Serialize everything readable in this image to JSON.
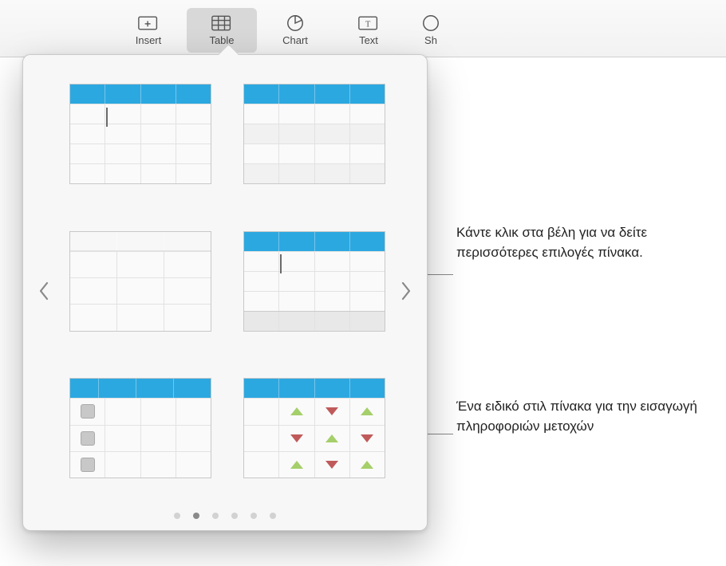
{
  "toolbar": {
    "items": [
      {
        "id": "insert",
        "label": "Insert",
        "active": false
      },
      {
        "id": "table",
        "label": "Table",
        "active": true
      },
      {
        "id": "chart",
        "label": "Chart",
        "active": false
      },
      {
        "id": "text",
        "label": "Text",
        "active": false
      },
      {
        "id": "shape",
        "label": "Shape",
        "active": false
      }
    ]
  },
  "popover": {
    "pages": {
      "total": 6,
      "current": 2
    },
    "styles": [
      {
        "id": "header-simple",
        "header": "blue",
        "rows": 4,
        "cols": 4,
        "cursor": [
          1,
          1
        ]
      },
      {
        "id": "header-banded",
        "header": "blue",
        "rows": 4,
        "cols": 4,
        "banded": true
      },
      {
        "id": "plain",
        "header": "plain",
        "rows": 4,
        "cols": 3
      },
      {
        "id": "header-footer",
        "header": "blue",
        "rows": 4,
        "cols": 4,
        "footer": true,
        "cursor": [
          1,
          1
        ]
      },
      {
        "id": "checkbox",
        "header": "blue",
        "rows": 3,
        "cols": 3,
        "firstColCheck": true
      },
      {
        "id": "stocks",
        "header": "blue",
        "rows": 3,
        "cols": 4,
        "triangles": [
          [
            "up",
            "down",
            "up"
          ],
          [
            "down",
            "up",
            "down"
          ],
          [
            "up",
            "down",
            "up"
          ]
        ]
      }
    ]
  },
  "callouts": {
    "arrows": "Κάντε κλικ στα βέλη για να δείτε περισσότερες επιλογές πίνακα.",
    "stocks": "Ένα ειδικό στιλ πίνακα για την εισαγωγή πληροφοριών μετοχών"
  },
  "icons": {
    "insert": "insert-icon",
    "table": "table-icon",
    "chart": "chart-icon",
    "text": "text-icon",
    "shape": "shape-icon",
    "chevronLeft": "chevron-left-icon",
    "chevronRight": "chevron-right-icon"
  },
  "colors": {
    "accent": "#2ca8e0",
    "triUp": "#a5cf6a",
    "triDown": "#c05a5a"
  }
}
